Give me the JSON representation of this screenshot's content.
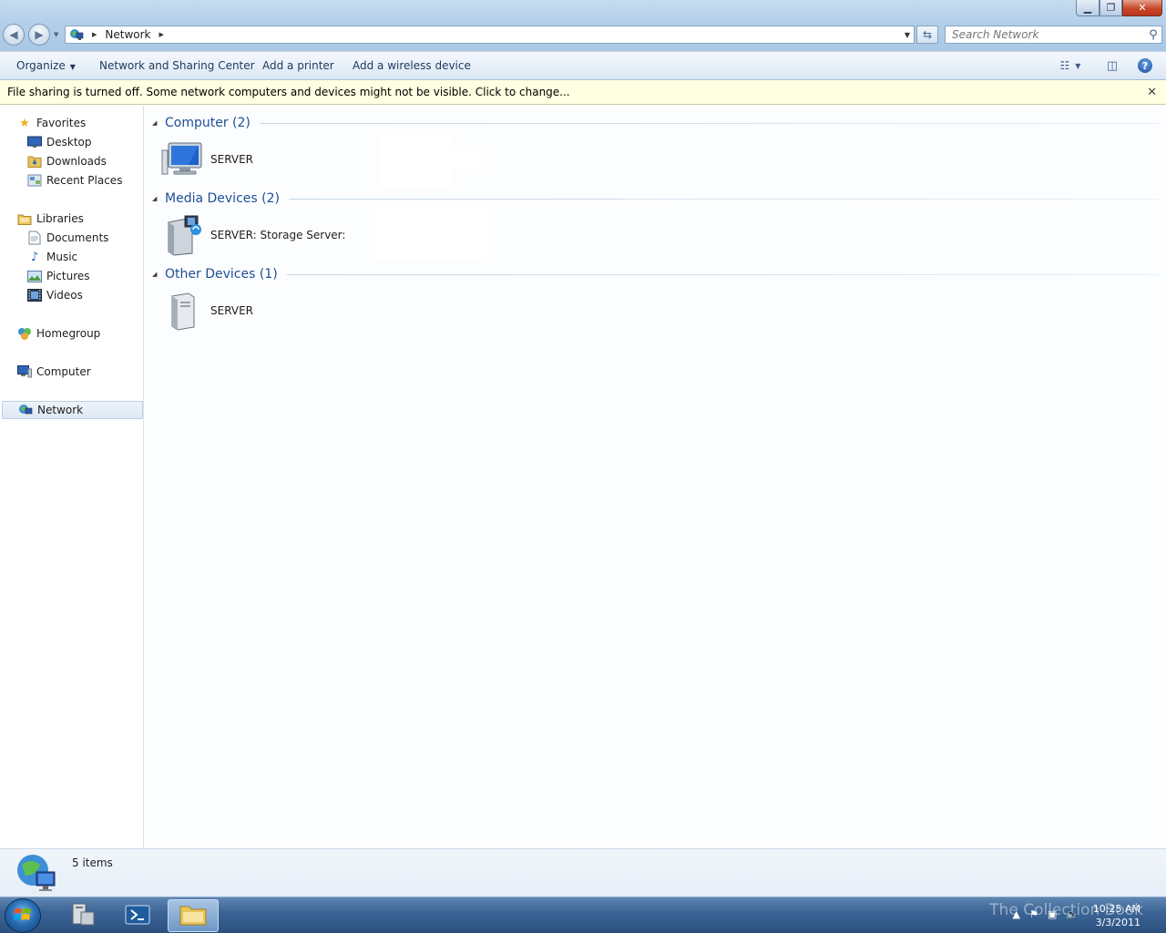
{
  "window": {
    "minimize_glyph": "▁",
    "maximize_glyph": "❐",
    "close_glyph": "✕"
  },
  "address": {
    "crumbs": [
      "Network"
    ]
  },
  "search": {
    "placeholder": "Search Network"
  },
  "toolbar": {
    "organize": "Organize",
    "network_sharing_center": "Network and Sharing Center",
    "add_printer": "Add a printer",
    "add_wireless_device": "Add a wireless device"
  },
  "infobar": {
    "message": "File sharing is turned off. Some network computers and devices might not be visible. Click to change..."
  },
  "nav": {
    "favorites": "Favorites",
    "desktop": "Desktop",
    "downloads": "Downloads",
    "recent_places": "Recent Places",
    "libraries": "Libraries",
    "documents": "Documents",
    "music": "Music",
    "pictures": "Pictures",
    "videos": "Videos",
    "homegroup": "Homegroup",
    "computer": "Computer",
    "network": "Network"
  },
  "groups": [
    {
      "title": "Computer (2)",
      "items": [
        "SERVER"
      ]
    },
    {
      "title": "Media Devices (2)",
      "items": [
        "SERVER: Storage Server:"
      ]
    },
    {
      "title": "Other Devices (1)",
      "items": [
        "SERVER"
      ]
    }
  ],
  "details": {
    "count": "5 items"
  },
  "taskbar": {
    "time": "10:25 AM",
    "date": "3/3/2011",
    "watermark": "The Collection Book"
  },
  "colors": {
    "group_header": "#1e4e96",
    "infobar_bg": "#ffffe1",
    "taskbar": "#3c6595"
  }
}
